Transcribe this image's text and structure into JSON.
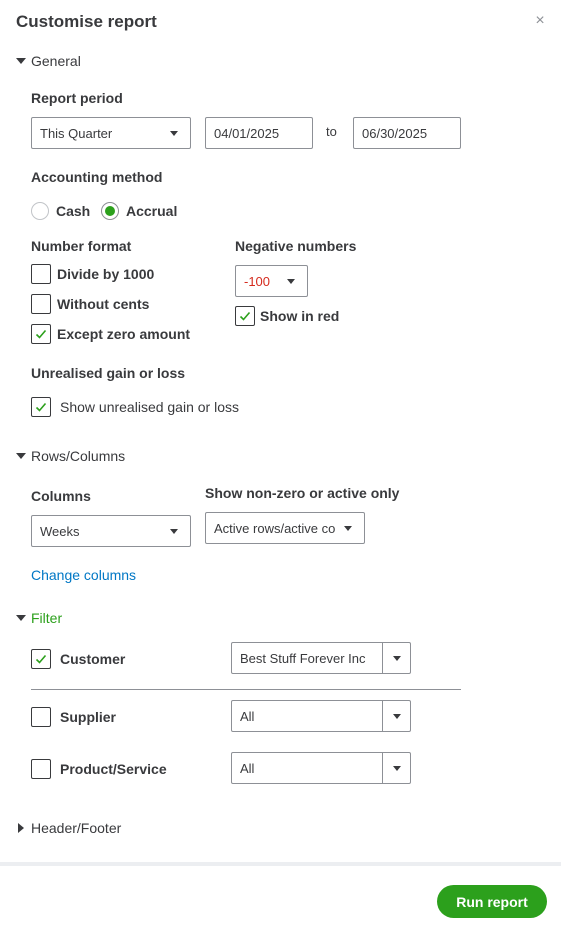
{
  "dialog": {
    "title": "Customise report",
    "close_icon": "×"
  },
  "general": {
    "heading": "General",
    "report_period": {
      "label": "Report period",
      "selected": "This Quarter",
      "from": "04/01/2025",
      "to_label": "to",
      "to": "06/30/2025"
    },
    "accounting_method": {
      "label": "Accounting method",
      "options": [
        "Cash",
        "Accrual"
      ],
      "selected": "Accrual"
    },
    "number_format": {
      "label": "Number format",
      "options": [
        {
          "label": "Divide by 1000",
          "checked": false
        },
        {
          "label": "Without cents",
          "checked": false
        },
        {
          "label": "Except zero amount",
          "checked": true
        }
      ]
    },
    "negative_numbers": {
      "label": "Negative numbers",
      "selected": "-100",
      "selected_color": "#d52b1e",
      "show_in_red": {
        "label": "Show in red",
        "checked": true
      }
    },
    "unrealised": {
      "label": "Unrealised gain or loss",
      "option": {
        "label": "Show unrealised gain or loss",
        "checked": true
      }
    }
  },
  "rows_columns": {
    "heading": "Rows/Columns",
    "columns": {
      "label": "Columns",
      "selected": "Weeks"
    },
    "non_zero": {
      "label": "Show non-zero or active only",
      "selected": "Active rows/active co"
    },
    "change_columns_link": "Change columns"
  },
  "filter": {
    "heading": "Filter",
    "heading_color": "#2ca01c",
    "rows": [
      {
        "label": "Customer",
        "checked": true,
        "value": "Best Stuff Forever Inc"
      },
      {
        "label": "Supplier",
        "checked": false,
        "value": "All"
      },
      {
        "label": "Product/Service",
        "checked": false,
        "value": "All"
      }
    ]
  },
  "header_footer": {
    "heading": "Header/Footer"
  },
  "actions": {
    "run_report": "Run report"
  },
  "colors": {
    "accent": "#2ca01c",
    "link": "#0077c5",
    "text": "#393a3d"
  }
}
